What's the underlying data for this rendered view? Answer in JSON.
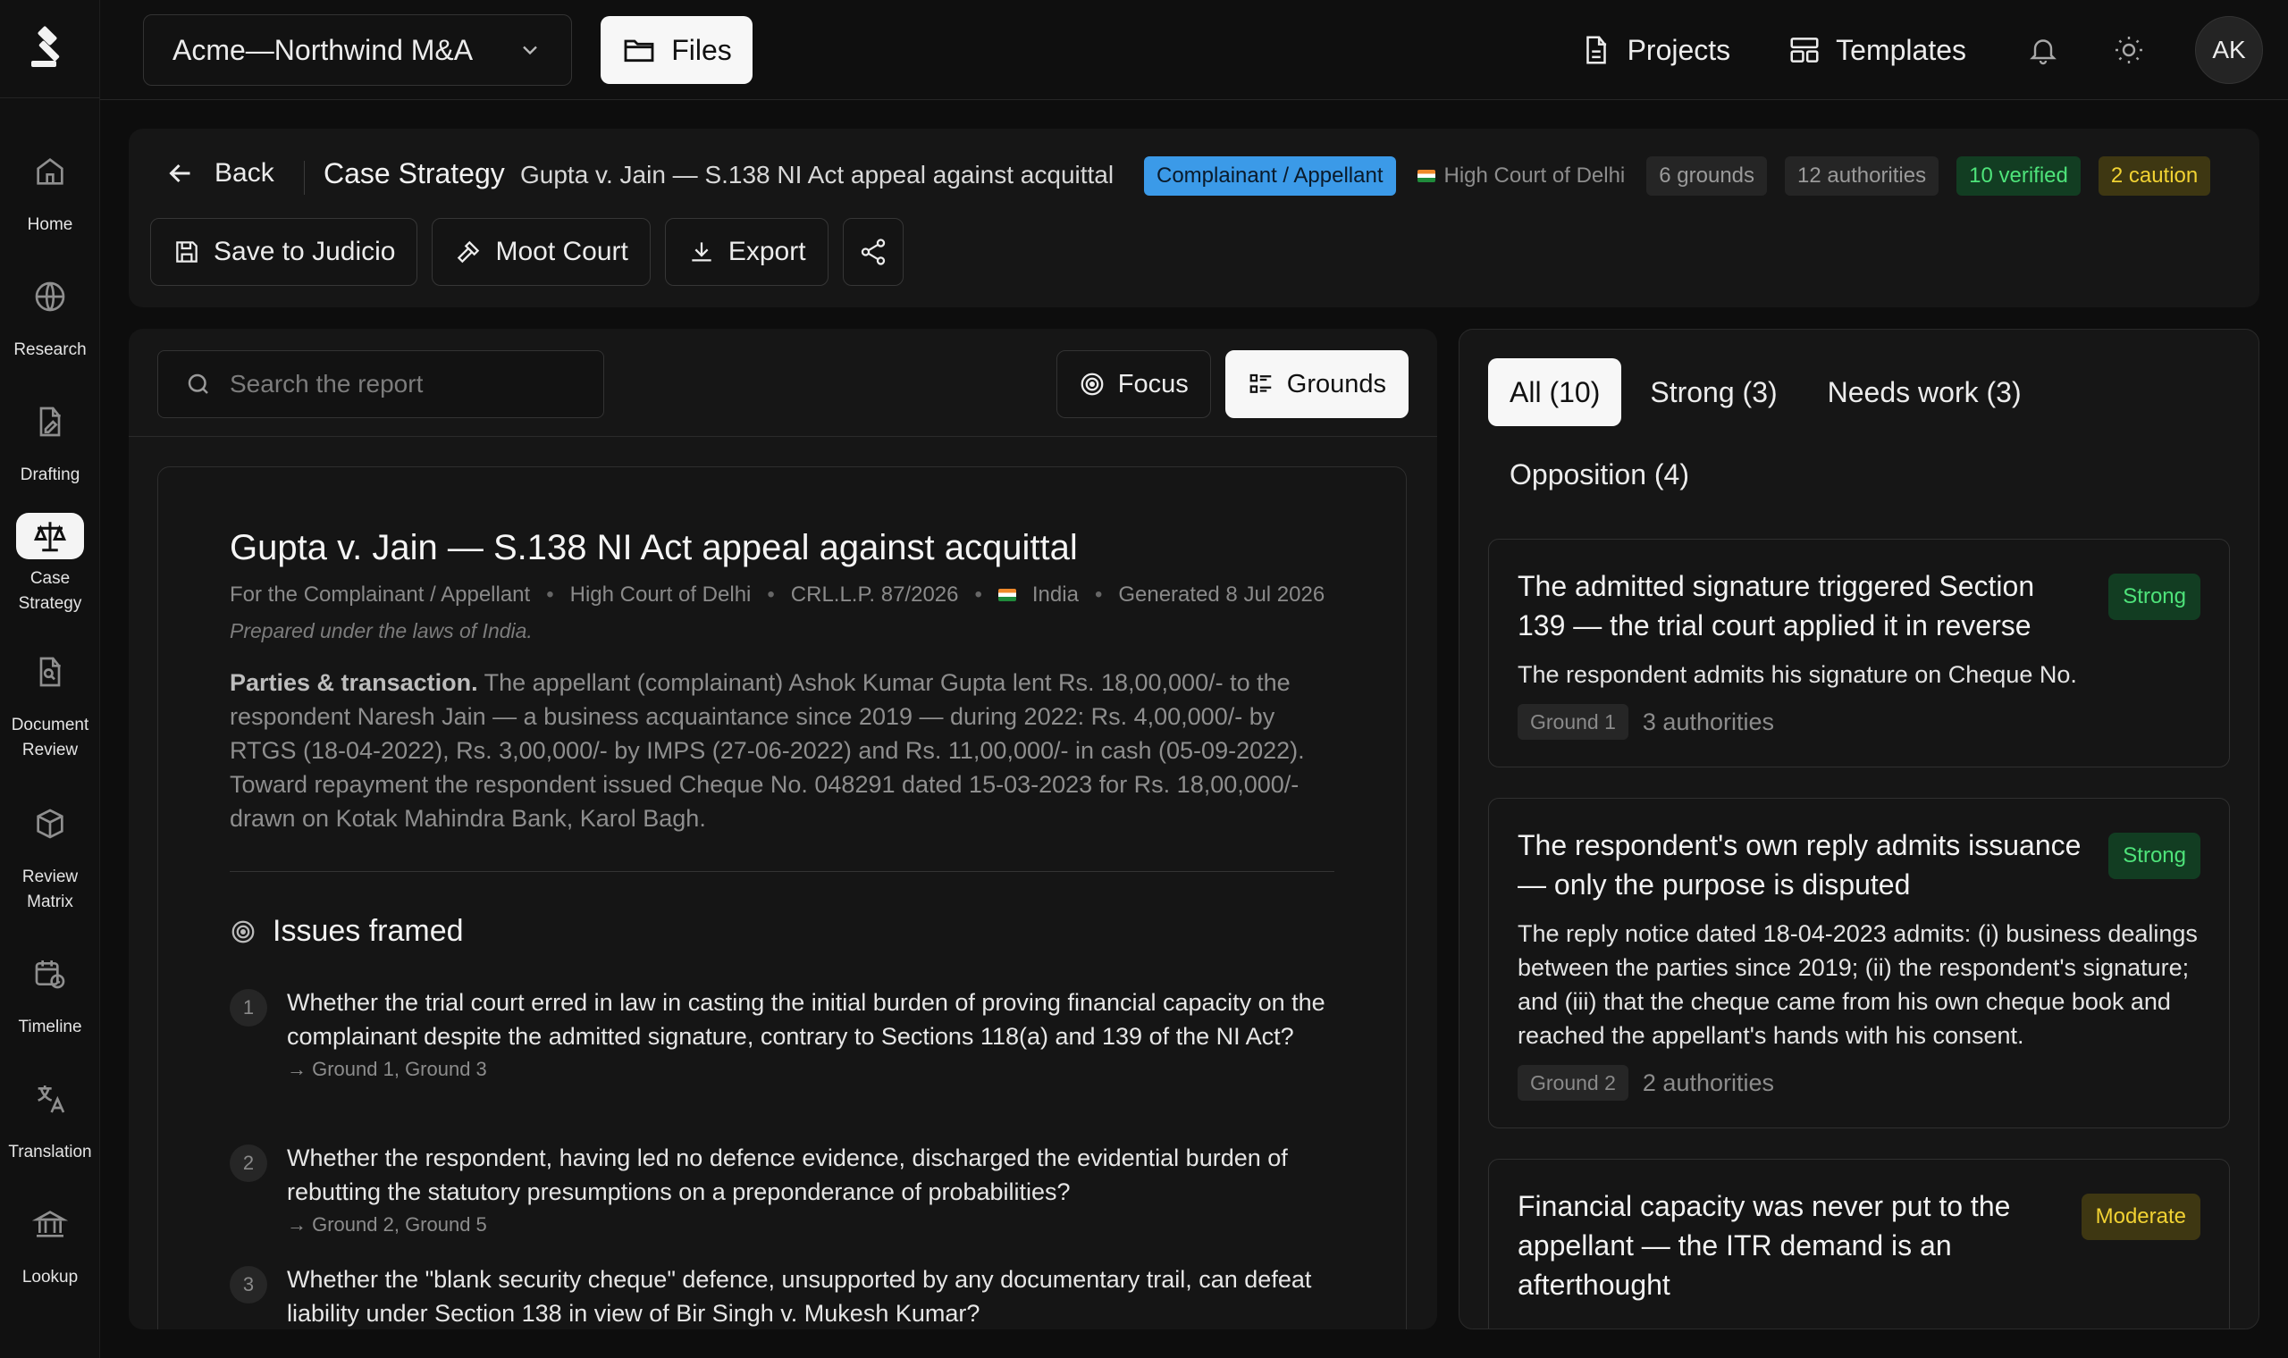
{
  "sidebar": {
    "items": [
      {
        "label": "Home",
        "icon": "home-icon"
      },
      {
        "label": "Research",
        "icon": "globe-icon"
      },
      {
        "label": "Drafting",
        "icon": "pen-document-icon"
      },
      {
        "label": "Case\nStrategy",
        "icon": "scales-icon",
        "active": true
      },
      {
        "label": "Document\nReview",
        "icon": "document-search-icon"
      },
      {
        "label": "Review\nMatrix",
        "icon": "cube-icon"
      },
      {
        "label": "Timeline",
        "icon": "calendar-clock-icon"
      },
      {
        "label": "Translation",
        "icon": "translate-icon"
      },
      {
        "label": "Lookup",
        "icon": "courthouse-icon"
      }
    ]
  },
  "topbar": {
    "project": "Acme—Northwind M&A",
    "files_label": "Files",
    "projects_label": "Projects",
    "templates_label": "Templates",
    "avatar_initials": "AK"
  },
  "header": {
    "back_label": "Back",
    "title": "Case Strategy",
    "subtitle": "Gupta v. Jain — S.138 NI Act appeal against acquittal",
    "badges": {
      "party": "Complainant / Appellant",
      "court": "High Court of Delhi",
      "grounds": "6 grounds",
      "authorities": "12 authorities",
      "verified": "10 verified",
      "caution": "2 caution"
    },
    "actions": {
      "save": "Save to Judicio",
      "moot": "Moot Court",
      "export": "Export"
    }
  },
  "main": {
    "search_placeholder": "Search the report",
    "focus_label": "Focus",
    "grounds_label": "Grounds",
    "report": {
      "title": "Gupta v. Jain — S.138 NI Act appeal against acquittal",
      "meta": {
        "party": "For the Complainant / Appellant",
        "court": "High Court of Delhi",
        "case_no": "CRL.L.P. 87/2026",
        "country": "India",
        "generated": "Generated 8 Jul 2026"
      },
      "prepared": "Prepared under the laws of India.",
      "parties_heading": "Parties & transaction.",
      "parties_text": "The appellant (complainant) Ashok Kumar Gupta lent Rs. 18,00,000/- to the respondent Naresh Jain — a business acquaintance since 2019 — during 2022: Rs. 4,00,000/- by RTGS (18-04-2022), Rs. 3,00,000/- by IMPS (27-06-2022) and Rs. 11,00,000/- in cash (05-09-2022). Toward repayment the respondent issued Cheque No. 048291 dated 15-03-2023 for Rs. 18,00,000/- drawn on Kotak Mahindra Bank, Karol Bagh.",
      "issues_heading": "Issues framed",
      "issues": [
        {
          "num": "1",
          "text": "Whether the trial court erred in law in casting the initial burden of proving financial capacity on the complainant despite the admitted signature, contrary to Sections 118(a) and 139 of the NI Act?",
          "refs": "→ Ground 1, Ground 3"
        },
        {
          "num": "2",
          "text": "Whether the respondent, having led no defence evidence, discharged the evidential burden of rebutting the statutory presumptions on a preponderance of probabilities?",
          "refs": "→ Ground 2, Ground 5"
        },
        {
          "num": "3",
          "text": "Whether the \"blank security cheque\" defence, unsupported by any documentary trail, can defeat liability under Section 138 in view of Bir Singh v. Mukesh Kumar?",
          "refs": ""
        }
      ]
    }
  },
  "right": {
    "tabs": [
      "All (10)",
      "Strong (3)",
      "Needs work (3)",
      "Opposition (4)"
    ],
    "cards": [
      {
        "title": "The admitted signature triggered Section 139 — the trial court applied it in reverse",
        "strength": "Strong",
        "body": "The respondent admits his signature on Cheque No.",
        "ground": "Ground 1",
        "authorities": "3 authorities"
      },
      {
        "title": "The respondent's own reply admits issuance — only the purpose is disputed",
        "strength": "Strong",
        "body": "The reply notice dated 18-04-2023 admits: (i) business dealings between the parties since 2019; (ii) the respondent's signature; and (iii) that the cheque came from his own cheque book and reached the appellant's hands with his consent.",
        "ground": "Ground 2",
        "authorities": "2 authorities"
      },
      {
        "title": "Financial capacity was never put to the appellant — the ITR demand is an afterthought",
        "strength": "Moderate",
        "body": "",
        "ground": "",
        "authorities": ""
      }
    ]
  },
  "colors": {
    "accent_blue": "#3b9ae8",
    "strong_green": "#4ee37a",
    "caution_yellow": "#f1d233",
    "background": "#0d0d0d"
  }
}
